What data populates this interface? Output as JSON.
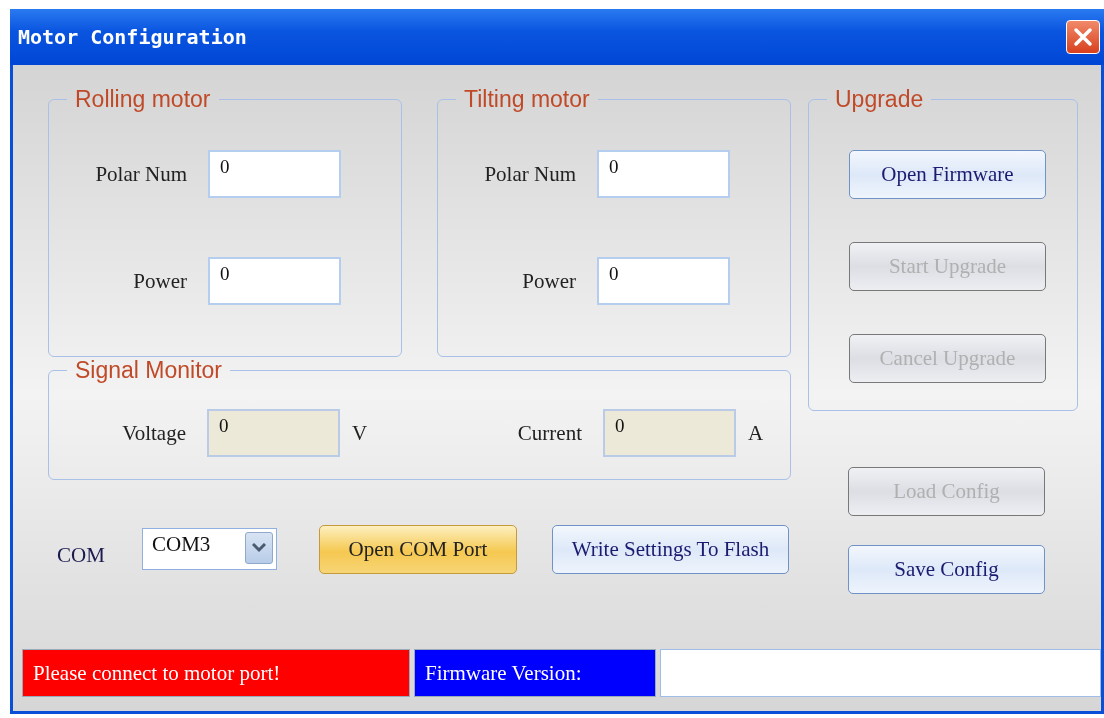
{
  "window": {
    "title": "Motor Configuration"
  },
  "rolling_motor": {
    "title": "Rolling motor",
    "fields": [
      {
        "label": "Polar Num",
        "value": "0",
        "disabled": false
      },
      {
        "label": "Power",
        "value": "0",
        "disabled": false
      }
    ]
  },
  "tilting_motor": {
    "title": "Tilting motor",
    "fields": [
      {
        "label": "Polar Num",
        "value": "0",
        "disabled": false
      },
      {
        "label": "Power",
        "value": "0",
        "disabled": false
      }
    ]
  },
  "signal_monitor": {
    "title": "Signal Monitor",
    "fields": [
      {
        "label": "Voltage",
        "value": "0",
        "unit": "V",
        "disabled": true
      },
      {
        "label": "Current",
        "value": "0",
        "unit": "A",
        "disabled": true
      }
    ]
  },
  "com": {
    "label": "COM",
    "value": "COM3"
  },
  "actions": [
    {
      "label": "Open COM Port",
      "highlighted": true,
      "disabled": false
    },
    {
      "label": "Write Settings To Flash",
      "highlighted": false,
      "disabled": false
    }
  ],
  "upgrade": {
    "title": "Upgrade",
    "buttons": [
      {
        "label": "Open Firmware",
        "highlighted": false,
        "disabled": false
      },
      {
        "label": "Start Upgrade",
        "highlighted": false,
        "disabled": true
      },
      {
        "label": "Cancel Upgrade",
        "highlighted": false,
        "disabled": true
      }
    ]
  },
  "config_buttons": [
    {
      "label": "Load Config",
      "highlighted": false,
      "disabled": true
    },
    {
      "label": "Save Config",
      "highlighted": false,
      "disabled": false
    }
  ],
  "status_bar": [
    {
      "text": "Please connect to motor port!",
      "color": "#ff0000"
    },
    {
      "text": "Firmware Version:",
      "color": "#0000ff"
    }
  ]
}
